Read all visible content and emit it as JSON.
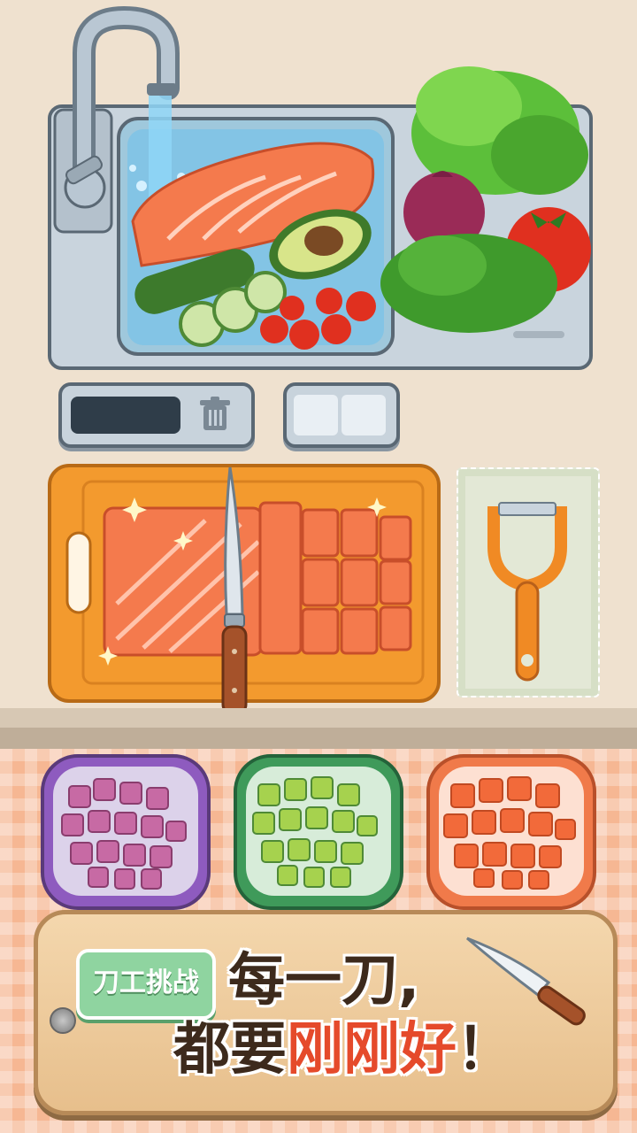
{
  "banner": {
    "tag": "刀工挑战",
    "line1": "每一刀,",
    "line2_prefix": "都要",
    "line2_highlight": "刚刚好",
    "line2_suffix": "！"
  },
  "colors": {
    "wall": "#efe1cf",
    "floor": "#f6b793",
    "tag_green": "#8fd4a0",
    "highlight_red": "#e54a2b",
    "board_orange": "#f39a2e",
    "salmon": "#f47a4d"
  },
  "icons": {
    "trash": "trash-icon",
    "knife": "knife-icon",
    "peeler": "peeler-icon",
    "faucet": "faucet-icon"
  }
}
